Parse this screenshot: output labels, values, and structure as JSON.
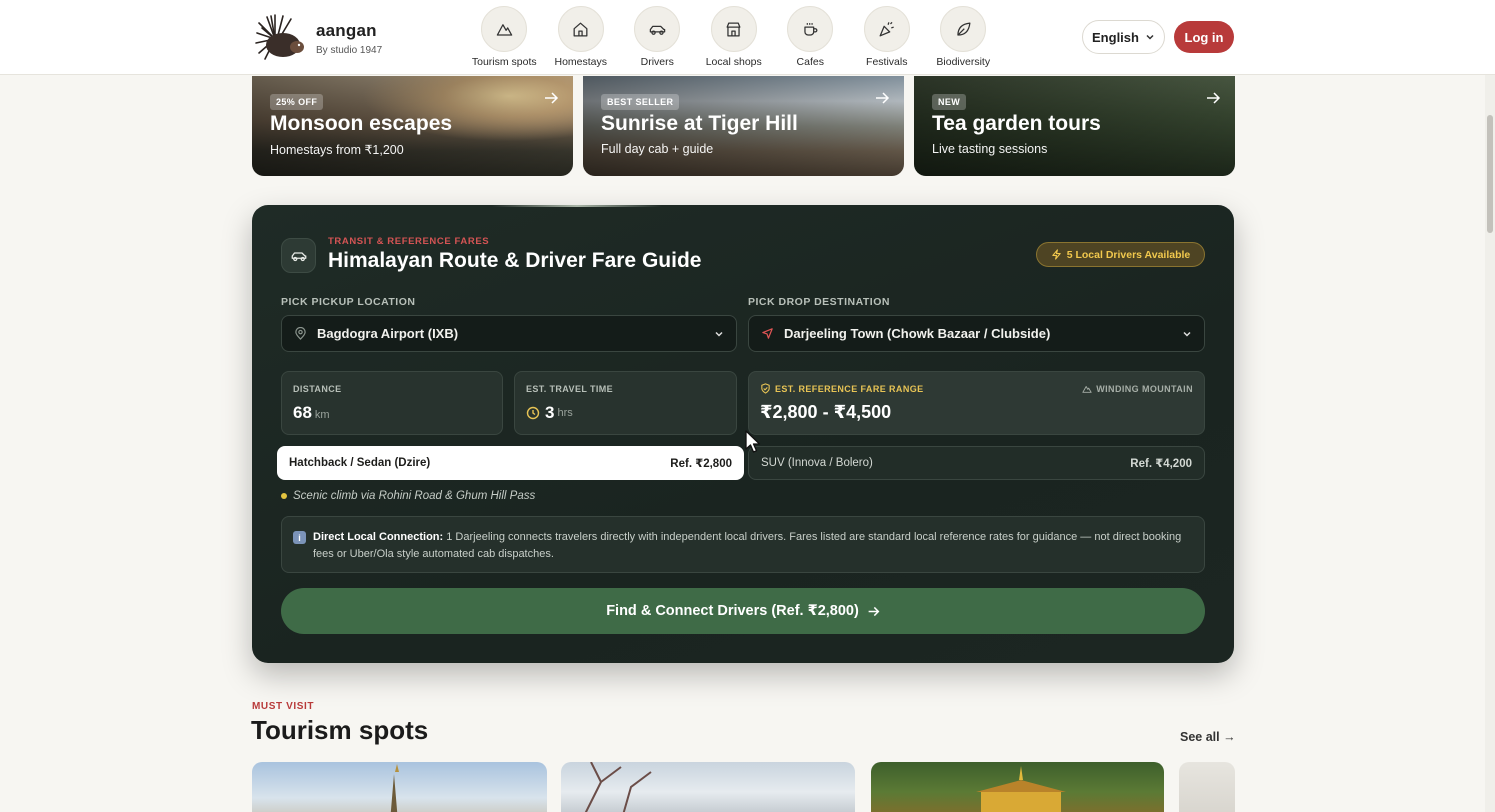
{
  "brand": {
    "name": "aangan",
    "subtitle": "By studio 1947"
  },
  "nav": [
    {
      "label": "Tourism spots",
      "icon": "mountain-icon"
    },
    {
      "label": "Homestays",
      "icon": "home-icon"
    },
    {
      "label": "Drivers",
      "icon": "car-icon"
    },
    {
      "label": "Local shops",
      "icon": "store-icon"
    },
    {
      "label": "Cafes",
      "icon": "coffee-icon"
    },
    {
      "label": "Festivals",
      "icon": "party-popper-icon"
    },
    {
      "label": "Biodiversity",
      "icon": "leaf-icon"
    }
  ],
  "header": {
    "language": "English",
    "login": "Log in"
  },
  "promos": [
    {
      "badge": "25% OFF",
      "title": "Monsoon escapes",
      "subtitle": "Homestays from ₹1,200"
    },
    {
      "badge": "BEST SELLER",
      "title": "Sunrise at Tiger Hill",
      "subtitle": "Full day cab + guide"
    },
    {
      "badge": "NEW",
      "title": "Tea garden tours",
      "subtitle": "Live tasting sessions"
    }
  ],
  "fare": {
    "eyebrow": "TRANSIT & REFERENCE FARES",
    "title": "Himalayan Route & Driver Fare Guide",
    "availability": "5 Local Drivers Available",
    "pickup_label": "PICK PICKUP LOCATION",
    "pickup_value": "Bagdogra Airport (IXB)",
    "drop_label": "PICK DROP DESTINATION",
    "drop_value": "Darjeeling Town (Chowk Bazaar / Clubside)",
    "distance_label": "DISTANCE",
    "distance_value": "68",
    "distance_unit": "km",
    "time_label": "EST. TRAVEL TIME",
    "time_value": "3",
    "time_unit": "hrs",
    "range_label": "EST. REFERENCE FARE RANGE",
    "terrain": "WINDING MOUNTAIN",
    "range_value": "₹2,800 - ₹4,500",
    "vehicles": [
      {
        "name": "Hatchback / Sedan (Dzire)",
        "ref": "Ref. ₹2,800",
        "selected": true
      },
      {
        "name": "SUV (Innova / Bolero)",
        "ref": "Ref. ₹4,200",
        "selected": false
      }
    ],
    "route_note": "Scenic climb via Rohini Road & Ghum Hill Pass",
    "info_title": "Direct Local Connection:",
    "info_body": "1 Darjeeling connects travelers directly with independent local drivers. Fares listed are standard local reference rates for guidance — not direct booking fees or Uber/Ola style automated cab dispatches.",
    "cta": "Find & Connect Drivers (Ref. ₹2,800)"
  },
  "tourism": {
    "eyebrow": "MUST VISIT",
    "title": "Tourism spots",
    "see_all": "See all →"
  },
  "colors": {
    "accent_red": "#b83a3a",
    "panel_bg": "#1f2b26",
    "cta_green": "#3f6b47",
    "gold": "#f1c84d"
  }
}
